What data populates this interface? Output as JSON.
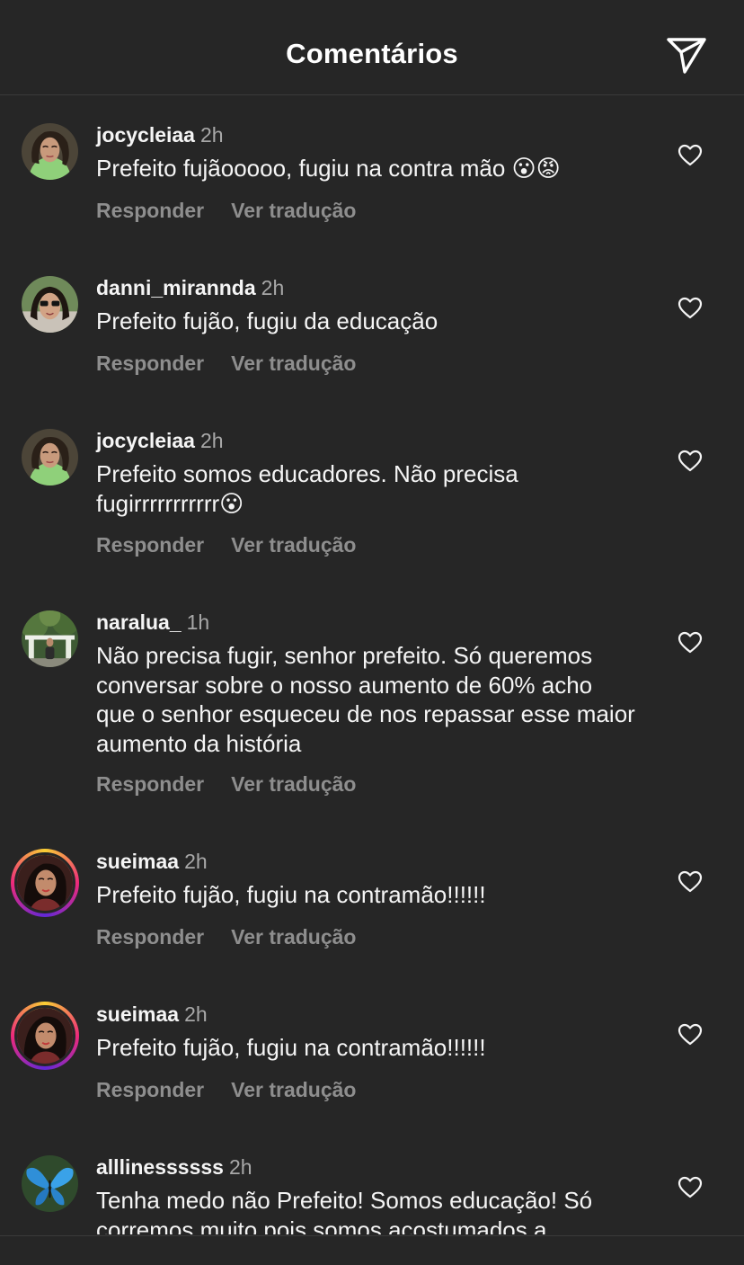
{
  "header": {
    "title": "Comentários"
  },
  "actions": {
    "reply": "Responder",
    "translate": "Ver tradução"
  },
  "comments": [
    {
      "username": "jocycleiaa",
      "time": "2h",
      "text": "Prefeito fujãooooo, fugiu na contra mão",
      "emojis": [
        "😮",
        "😡"
      ],
      "avatar_story_ring": false,
      "avatar_icon": "woman-portrait-avatar"
    },
    {
      "username": "danni_mirannda",
      "time": "2h",
      "text": "Prefeito fujão, fugiu da educação",
      "avatar_story_ring": false,
      "avatar_icon": "woman-sunglasses-avatar"
    },
    {
      "username": "jocycleiaa",
      "time": "2h",
      "text": "Prefeito somos educadores. Não precisa fugirrrrrrrrrrr",
      "emojis": [
        "😮"
      ],
      "avatar_story_ring": false,
      "avatar_icon": "woman-portrait-avatar"
    },
    {
      "username": "naralua_",
      "time": "1h",
      "text": "Não precisa fugir, senhor prefeito. Só queremos conversar sobre o nosso aumento de 60% acho que o senhor esqueceu  de nos repassar esse maior aumento da história",
      "avatar_story_ring": false,
      "avatar_icon": "park-photo-avatar"
    },
    {
      "username": "sueimaa",
      "time": "2h",
      "text": "Prefeito fujão,  fugiu na contramão!!!!!!",
      "avatar_story_ring": true,
      "avatar_icon": "woman-portrait-avatar"
    },
    {
      "username": "sueimaa",
      "time": "2h",
      "text": "Prefeito fujão,  fugiu na contramão!!!!!!",
      "avatar_story_ring": true,
      "avatar_icon": "woman-portrait-avatar"
    },
    {
      "username": "alllinessssss",
      "time": "2h",
      "text": "Tenha medo não Prefeito! Somos educação! Só corremos muito pois somos acostumados a",
      "avatar_story_ring": false,
      "avatar_icon": "blue-butterfly-avatar"
    }
  ],
  "colors": {
    "background": "#262626",
    "text": "#f5f5f5",
    "secondary": "#a8a8a8",
    "action": "#8e8e8e",
    "divider": "#3a3a3a"
  },
  "icons": {
    "send": "paper-plane-icon",
    "like": "heart-outline-icon"
  }
}
